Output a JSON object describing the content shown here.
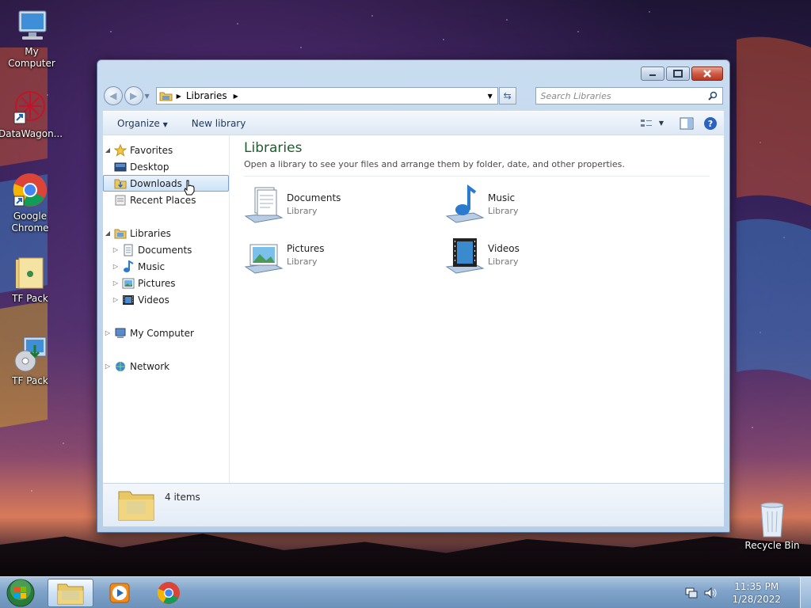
{
  "desktop": {
    "icons": [
      {
        "label": "My Computer",
        "icon": "computer-icon"
      },
      {
        "label": "DataWagon...",
        "icon": "datawagon-icon"
      },
      {
        "label": "Google Chrome",
        "icon": "chrome-icon"
      },
      {
        "label": "TF Pack",
        "icon": "folder-icon"
      },
      {
        "label": "TF Pack",
        "icon": "installer-icon"
      },
      {
        "label": "Recycle Bin",
        "icon": "recycle-bin-icon"
      }
    ]
  },
  "window": {
    "address": {
      "breadcrumb": "Libraries"
    },
    "search": {
      "placeholder": "Search Libraries"
    },
    "toolbar": {
      "organize": "Organize",
      "new_library": "New library"
    },
    "nav": {
      "favorites": {
        "label": "Favorites",
        "items": [
          "Desktop",
          "Downloads",
          "Recent Places"
        ]
      },
      "libraries": {
        "label": "Libraries",
        "items": [
          "Documents",
          "Music",
          "Pictures",
          "Videos"
        ]
      },
      "computer": "My Computer",
      "network": "Network",
      "selected": "Downloads"
    },
    "main": {
      "title": "Libraries",
      "description": "Open a library to see your files and arrange them by folder, date, and other properties.",
      "libraries": [
        {
          "name": "Documents",
          "type": "Library",
          "icon": "documents-library-icon"
        },
        {
          "name": "Music",
          "type": "Library",
          "icon": "music-library-icon"
        },
        {
          "name": "Pictures",
          "type": "Library",
          "icon": "pictures-library-icon"
        },
        {
          "name": "Videos",
          "type": "Library",
          "icon": "videos-library-icon"
        }
      ]
    },
    "details": {
      "count": "4 items"
    }
  },
  "taskbar": {
    "buttons": [
      "start-orb-icon",
      "explorer-icon",
      "media-player-icon",
      "chrome-icon"
    ],
    "clock": {
      "time": "11:35 PM",
      "date": "1/28/2022"
    }
  },
  "colors": {
    "library_title": "#1e5c2f",
    "taskbar": "#7fa3c9",
    "close_button": "#cf5b45"
  }
}
